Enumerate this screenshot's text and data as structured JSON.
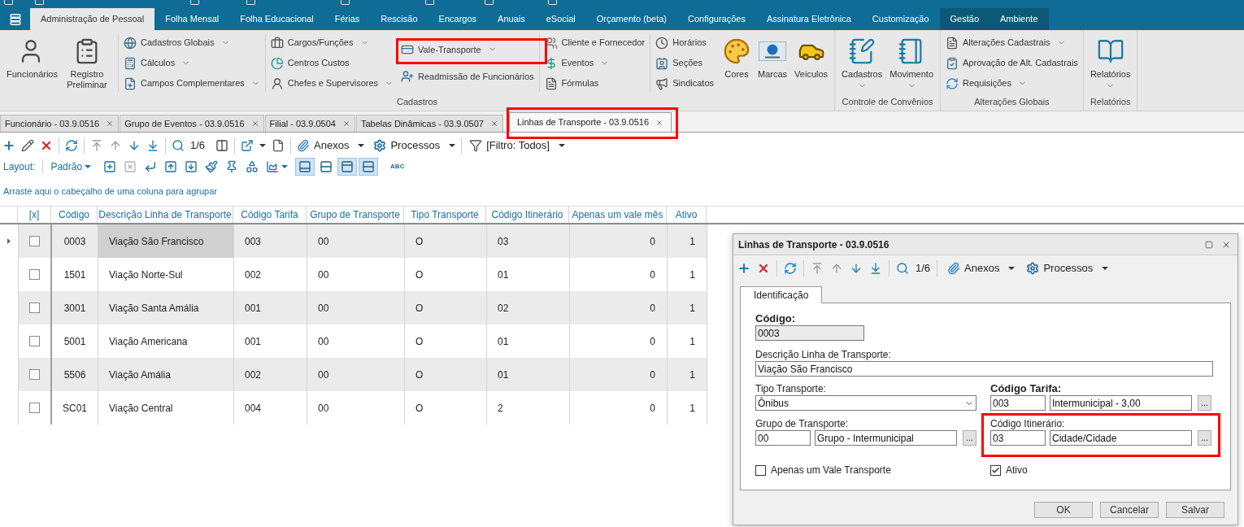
{
  "menu_tabs": [
    {
      "label": "Administração de Pessoal",
      "selected": true,
      "kind": "standard"
    },
    {
      "label": "Folha Mensal",
      "selected": false,
      "kind": "standard"
    },
    {
      "label": "Folha Educacional",
      "selected": false,
      "kind": "standard"
    },
    {
      "label": "Férias",
      "selected": false,
      "kind": "standard"
    },
    {
      "label": "Rescisão",
      "selected": false,
      "kind": "standard"
    },
    {
      "label": "Encargos",
      "selected": false,
      "kind": "standard"
    },
    {
      "label": "Anuais",
      "selected": false,
      "kind": "standard"
    },
    {
      "label": "eSocial",
      "selected": false,
      "kind": "standard"
    },
    {
      "label": "Orçamento (beta)",
      "selected": false,
      "kind": "standard"
    },
    {
      "label": "Configurações",
      "selected": false,
      "kind": "standard"
    },
    {
      "label": "Assinatura Eletrônica",
      "selected": false,
      "kind": "standard"
    },
    {
      "label": "Customização",
      "selected": false,
      "kind": "standard"
    },
    {
      "label": "Gestão",
      "selected": false,
      "kind": "contextual"
    },
    {
      "label": "Ambiente",
      "selected": false,
      "kind": "contextual"
    }
  ],
  "ribbon": [
    {
      "label": "Cadastros",
      "sections": [
        {
          "columns": [
            {
              "kind": "large",
              "items": [
                {
                  "label": "Funcionários",
                  "dropdown": false,
                  "highlighted": false
                },
                {
                  "label": "Registro Preliminar",
                  "dropdown": false,
                  "highlighted": false
                }
              ]
            }
          ]
        },
        {
          "columns": [
            {
              "kind": "small",
              "items": [
                {
                  "label": "Cadastros Globais",
                  "dropdown": true,
                  "highlighted": false
                },
                {
                  "label": "Cálculos",
                  "dropdown": true,
                  "highlighted": false
                },
                {
                  "label": "Campos Complementares",
                  "dropdown": true,
                  "highlighted": false
                }
              ]
            }
          ]
        },
        {
          "columns": [
            {
              "kind": "small",
              "items": [
                {
                  "label": "Cargos/Funções",
                  "dropdown": true,
                  "highlighted": false
                },
                {
                  "label": "Centros Custos",
                  "dropdown": false,
                  "highlighted": false
                },
                {
                  "label": "Chefes e Supervisores",
                  "dropdown": true,
                  "highlighted": false
                }
              ]
            },
            {
              "kind": "small",
              "items": [
                {
                  "label": "Vale-Transporte",
                  "dropdown": true,
                  "highlighted": true
                },
                {
                  "label": "Readmissão de Funcionários",
                  "dropdown": false,
                  "highlighted": false
                }
              ]
            }
          ]
        },
        {
          "columns": [
            {
              "kind": "small",
              "items": [
                {
                  "label": "Cliente e Fornecedor",
                  "dropdown": false,
                  "highlighted": false
                },
                {
                  "label": "Eventos",
                  "dropdown": true,
                  "highlighted": false
                },
                {
                  "label": "Fórmulas",
                  "dropdown": false,
                  "highlighted": false
                }
              ]
            }
          ]
        },
        {
          "columns": [
            {
              "kind": "small",
              "items": [
                {
                  "label": "Horários",
                  "dropdown": false,
                  "highlighted": false
                },
                {
                  "label": "Seções",
                  "dropdown": false,
                  "highlighted": false
                },
                {
                  "label": "Sindicatos",
                  "dropdown": false,
                  "highlighted": false
                }
              ]
            },
            {
              "kind": "large",
              "items": [
                {
                  "label": "Cores",
                  "dropdown": false,
                  "highlighted": false
                },
                {
                  "label": "Marcas",
                  "dropdown": false,
                  "highlighted": false
                },
                {
                  "label": "Veiculos",
                  "dropdown": false,
                  "highlighted": false
                }
              ]
            }
          ]
        }
      ]
    },
    {
      "label": "Controle de Convênios",
      "sections": [
        {
          "columns": [
            {
              "kind": "large",
              "items": [
                {
                  "label": "Cadastros",
                  "dropdown": true,
                  "highlighted": false
                },
                {
                  "label": "Movimento",
                  "dropdown": true,
                  "highlighted": false
                }
              ]
            }
          ]
        }
      ]
    },
    {
      "label": "Alterações Globais",
      "sections": [
        {
          "columns": [
            {
              "kind": "small",
              "items": [
                {
                  "label": "Alterações Cadastrais",
                  "dropdown": true,
                  "highlighted": false
                },
                {
                  "label": "Aprovação de Alt. Cadastrais",
                  "dropdown": false,
                  "highlighted": false
                },
                {
                  "label": "Requisições",
                  "dropdown": true,
                  "highlighted": false
                }
              ]
            }
          ]
        }
      ]
    },
    {
      "label": "Relatórios",
      "sections": [
        {
          "columns": [
            {
              "kind": "large",
              "items": [
                {
                  "label": "Relatórios",
                  "dropdown": true,
                  "highlighted": false
                }
              ]
            }
          ]
        }
      ]
    }
  ],
  "document_tabs": [
    {
      "label": "Funcionário - 03.9.0516",
      "selected": false,
      "highlighted": false
    },
    {
      "label": "Grupo de Eventos - 03.9.0516",
      "selected": false,
      "highlighted": false
    },
    {
      "label": "Filial - 03.9.0504",
      "selected": false,
      "highlighted": false
    },
    {
      "label": "Tabelas Dinâmicas - 03.9.0507",
      "selected": false,
      "highlighted": false
    },
    {
      "label": "Linhas de Transporte - 03.9.0516",
      "selected": true,
      "highlighted": true
    }
  ],
  "toolbar": {
    "counter": "1/6",
    "attachments": "Anexos",
    "processes": "Processos",
    "filter": "[Filtro: Todos]"
  },
  "layout_bar": {
    "label": "Layout:",
    "preset": "Padrão",
    "toggles": [
      {
        "pressed": true
      },
      {
        "pressed": false
      },
      {
        "pressed": true
      },
      {
        "pressed": true
      }
    ],
    "text_tool": "ABC"
  },
  "group_hint": "Arraste aqui o cabeçalho de uma coluna para agrupar",
  "table": {
    "columns": [
      {
        "label": "[x]",
        "kind": "check"
      },
      {
        "label": "Código",
        "kind": "code"
      },
      {
        "label": "Descrição Linha de Transporte",
        "kind": "text"
      },
      {
        "label": "Código Tarifa",
        "kind": "text"
      },
      {
        "label": "Grupo de Transporte",
        "kind": "text"
      },
      {
        "label": "Tipo Transporte",
        "kind": "text"
      },
      {
        "label": "Código Itinerário",
        "kind": "text"
      },
      {
        "label": "Apenas um vale mês",
        "kind": "number"
      },
      {
        "label": "Ativo",
        "kind": "number"
      }
    ],
    "rows": [
      {
        "selected": true,
        "cells": [
          {
            "checked": false,
            "focused": false
          },
          {
            "text": "0003",
            "focused": false
          },
          {
            "text": "Viação São Francisco",
            "focused": true
          },
          {
            "text": "003",
            "focused": false
          },
          {
            "text": "00",
            "focused": false
          },
          {
            "text": "O",
            "focused": false
          },
          {
            "text": "03",
            "focused": false
          },
          {
            "text": "0",
            "focused": false
          },
          {
            "text": "1",
            "focused": false
          }
        ]
      },
      {
        "selected": false,
        "cells": [
          {
            "checked": false,
            "focused": false
          },
          {
            "text": "1501",
            "focused": false
          },
          {
            "text": "Viação Norte-Sul",
            "focused": false
          },
          {
            "text": "002",
            "focused": false
          },
          {
            "text": "00",
            "focused": false
          },
          {
            "text": "O",
            "focused": false
          },
          {
            "text": "01",
            "focused": false
          },
          {
            "text": "0",
            "focused": false
          },
          {
            "text": "1",
            "focused": false
          }
        ]
      },
      {
        "selected": false,
        "cells": [
          {
            "checked": false,
            "focused": false
          },
          {
            "text": "3001",
            "focused": false
          },
          {
            "text": "Viação Santa Amália",
            "focused": false
          },
          {
            "text": "001",
            "focused": false
          },
          {
            "text": "00",
            "focused": false
          },
          {
            "text": "O",
            "focused": false
          },
          {
            "text": "02",
            "focused": false
          },
          {
            "text": "0",
            "focused": false
          },
          {
            "text": "1",
            "focused": false
          }
        ]
      },
      {
        "selected": false,
        "cells": [
          {
            "checked": false,
            "focused": false
          },
          {
            "text": "5001",
            "focused": false
          },
          {
            "text": "Viação Americana",
            "focused": false
          },
          {
            "text": "001",
            "focused": false
          },
          {
            "text": "00",
            "focused": false
          },
          {
            "text": "O",
            "focused": false
          },
          {
            "text": "01",
            "focused": false
          },
          {
            "text": "0",
            "focused": false
          },
          {
            "text": "1",
            "focused": false
          }
        ]
      },
      {
        "selected": false,
        "cells": [
          {
            "checked": false,
            "focused": false
          },
          {
            "text": "5506",
            "focused": false
          },
          {
            "text": "Viação Amália",
            "focused": false
          },
          {
            "text": "002",
            "focused": false
          },
          {
            "text": "00",
            "focused": false
          },
          {
            "text": "O",
            "focused": false
          },
          {
            "text": "01",
            "focused": false
          },
          {
            "text": "0",
            "focused": false
          },
          {
            "text": "1",
            "focused": false
          }
        ]
      },
      {
        "selected": false,
        "cells": [
          {
            "checked": false,
            "focused": false
          },
          {
            "text": "SC01",
            "focused": false
          },
          {
            "text": "Viação Central",
            "focused": false
          },
          {
            "text": "004",
            "focused": false
          },
          {
            "text": "00",
            "focused": false
          },
          {
            "text": "O",
            "focused": false
          },
          {
            "text": "2",
            "focused": false
          },
          {
            "text": "0",
            "focused": false
          },
          {
            "text": "1",
            "focused": false
          }
        ]
      }
    ]
  },
  "dialog": {
    "title": "Linhas de Transporte - 03.9.0516",
    "toolbar": {
      "counter": "1/6",
      "attachments": "Anexos",
      "processes": "Processos"
    },
    "tabs": [
      {
        "label": "Identificação",
        "selected": true
      }
    ],
    "form": {
      "code": {
        "label": "Código:",
        "value": "0003",
        "required": true,
        "readonly": true
      },
      "description": {
        "label": "Descrição Linha de Transporte:",
        "value": "Viação São Francisco",
        "required": false
      },
      "transport_type": {
        "label": "Tipo Transporte:",
        "value": "Ônibus",
        "required": false
      },
      "fare_code": {
        "label": "Código Tarifa:",
        "code": "003",
        "description": "Intermunicipal - 3,00",
        "lookup": "...",
        "required": true,
        "highlighted": false
      },
      "transport_group": {
        "label": "Grupo de Transporte:",
        "code": "00",
        "description": "Grupo - Intermunicipal",
        "lookup": "...",
        "required": false,
        "highlighted": false
      },
      "itinerary_code": {
        "label": "Código Itinerário:",
        "code": "03",
        "description": "Cidade/Cidade",
        "lookup": "...",
        "required": false,
        "highlighted": true
      },
      "checkboxes": [
        {
          "label": "Apenas um Vale Transporte",
          "checked": false
        },
        {
          "label": "Ativo",
          "checked": true
        }
      ]
    },
    "buttons": [
      {
        "label": "OK"
      },
      {
        "label": "Cancelar"
      },
      {
        "label": "Salvar"
      }
    ]
  }
}
